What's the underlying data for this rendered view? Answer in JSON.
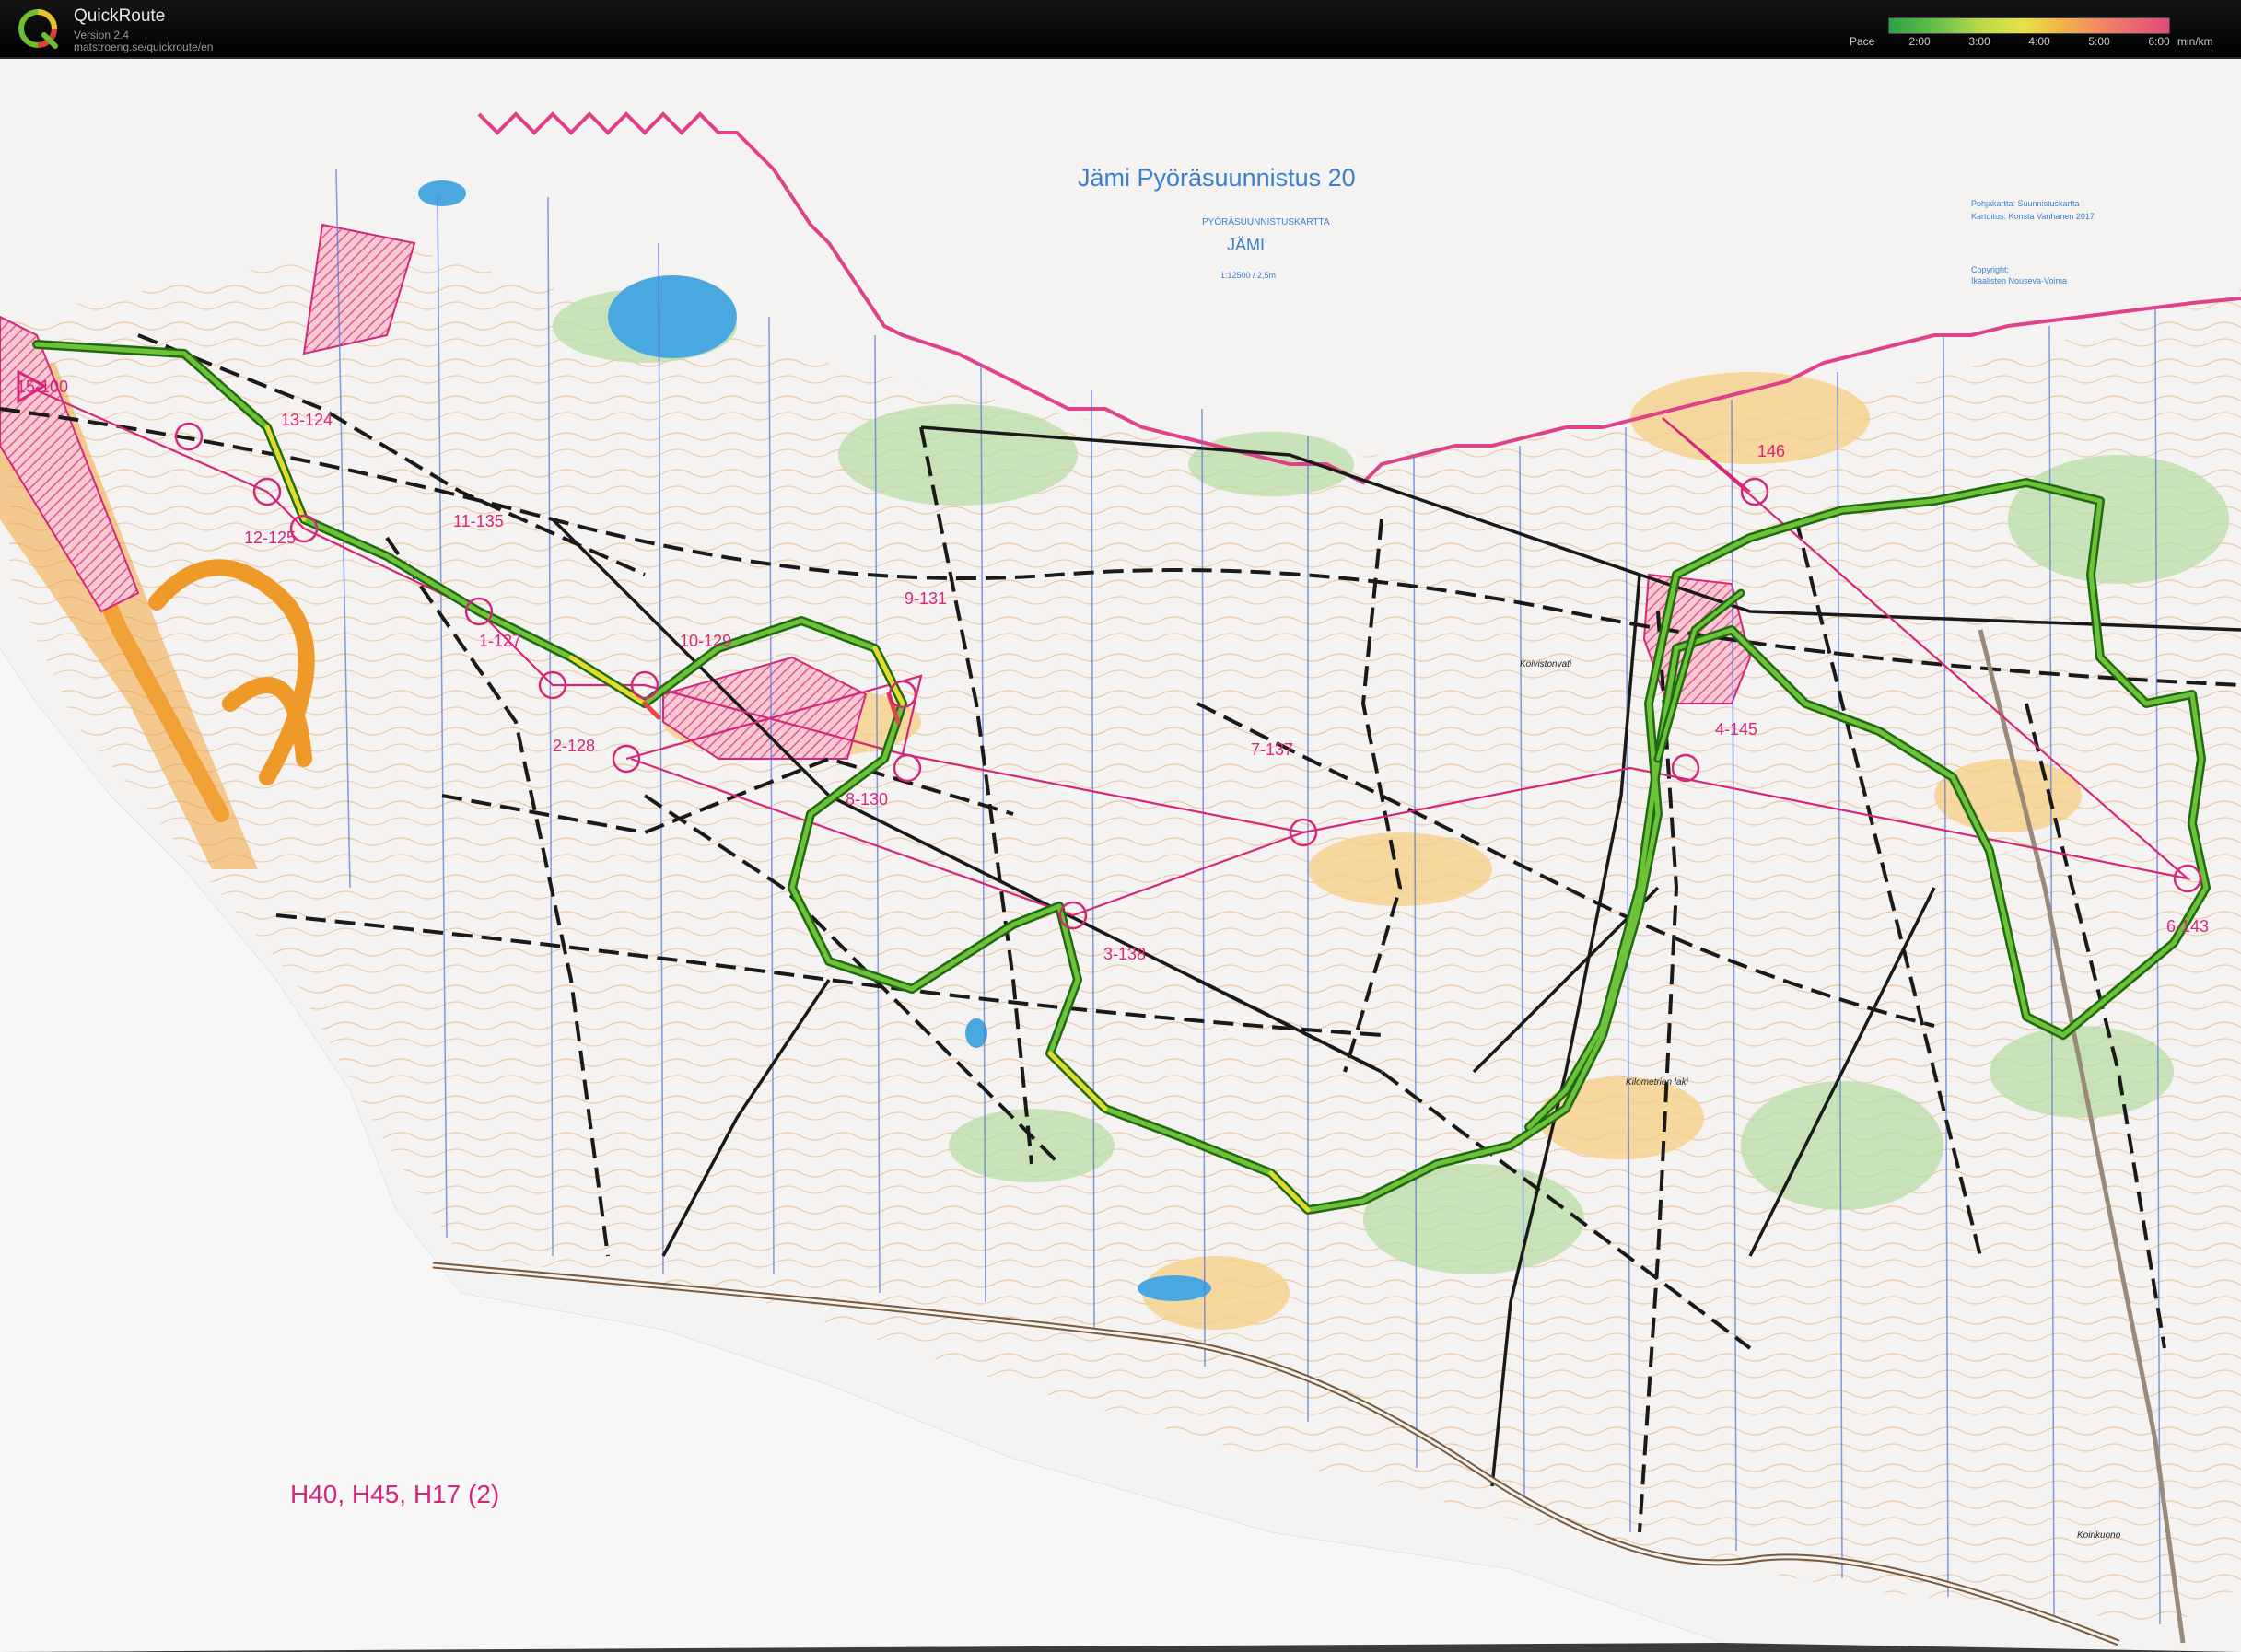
{
  "app": {
    "title": "QuickRoute",
    "version": "Version 2.4",
    "url": "matstroeng.se/quickroute/en"
  },
  "pace_legend": {
    "label": "Pace",
    "ticks": [
      "2:00",
      "3:00",
      "4:00",
      "5:00",
      "6:00"
    ],
    "unit": "min/km"
  },
  "map": {
    "event_title": "Jämi Pyöräsuunnistus 20",
    "map_type_label": "PYÖRÄSUUNNISTUSKARTTA",
    "map_name": "JÄMI",
    "scale_note": "1:12500 / 2,5m",
    "credits": [
      "Pohjakartta: Suunnistuskartta",
      "Kartoitus: Konsta Vanhanen 2017",
      "Copyright:",
      "Ikaalisten Nouseva-Voima"
    ],
    "class_label": "H40, H45, H17 (2)",
    "place_names": [
      "Koivistonvati",
      "Kilometrien laki",
      "Koirikuono"
    ],
    "controls": [
      "15-100",
      "13-124",
      "12-125",
      "11-135",
      "1-127",
      "10-129",
      "9-131",
      "2-128",
      "8-130",
      "3-138",
      "7-137",
      "4-145",
      "146",
      "6-143"
    ]
  },
  "colors": {
    "route_green": "#2f8a1e",
    "route_yellow": "#d8d22a",
    "course_magenta": "#d6267a",
    "contour": "#d98a3a",
    "road_black": "#1a1a1a",
    "water": "#4aa8e0",
    "meridian": "#5a78d8"
  }
}
